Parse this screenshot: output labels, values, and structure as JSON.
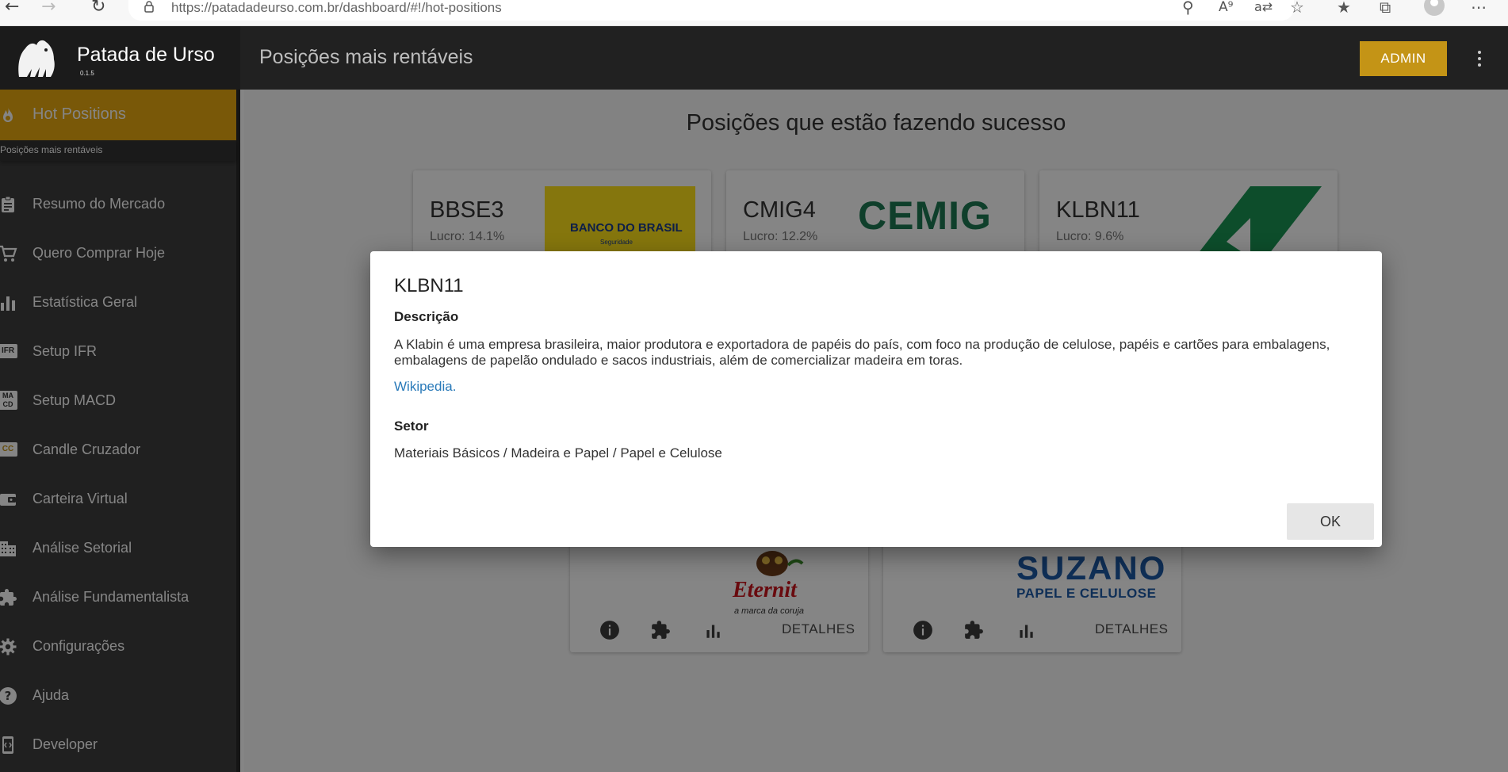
{
  "browser": {
    "url_host": "https://patadadeurso.com.br",
    "url_path": "/dashboard/#!/hot-positions"
  },
  "app": {
    "name": "Patada de Urso",
    "version": "0.1.5",
    "page_heading": "Posições mais rentáveis",
    "admin_label": "ADMIN"
  },
  "sidebar": {
    "active": {
      "label": "Hot Positions",
      "subtitle": "Posições mais rentáveis"
    },
    "items": [
      {
        "label": "Resumo do Mercado",
        "icon": "clipboard-icon"
      },
      {
        "label": "Quero Comprar Hoje",
        "icon": "cart-icon"
      },
      {
        "label": "Estatística Geral",
        "icon": "bar-chart-icon"
      },
      {
        "label": "Setup IFR",
        "icon": "ifr-icon",
        "icon_text": "IFR"
      },
      {
        "label": "Setup MACD",
        "icon": "macd-icon",
        "icon_text": "MA CD"
      },
      {
        "label": "Candle Cruzador",
        "icon": "candle-icon",
        "icon_text": "CC"
      },
      {
        "label": "Carteira Virtual",
        "icon": "wallet-icon"
      },
      {
        "label": "Análise Setorial",
        "icon": "building-icon"
      },
      {
        "label": "Análise Fundamentalista",
        "icon": "puzzle-icon"
      },
      {
        "label": "Configurações",
        "icon": "gear-icon"
      },
      {
        "label": "Ajuda",
        "icon": "help-icon"
      },
      {
        "label": "Developer",
        "icon": "developer-icon"
      }
    ]
  },
  "main": {
    "title": "Posições que estão fazendo sucesso",
    "cards": [
      {
        "ticker": "BBSE3",
        "profit": "Lucro: 14.1%",
        "logo_text": "BANCO DO BRASIL",
        "logo_sub": "Seguridade"
      },
      {
        "ticker": "CMIG4",
        "profit": "Lucro: 12.2%",
        "logo_text": "CEMIG"
      },
      {
        "ticker": "KLBN11",
        "profit": "Lucro: 9.6%"
      }
    ],
    "bottom_cards": [
      {
        "logo_text": "Eternit",
        "logo_sub": "a marca da coruja",
        "details_label": "DETALHES"
      },
      {
        "logo_text": "SUZANO",
        "logo_sub": "PAPEL E CELULOSE",
        "details_label": "DETALHES"
      }
    ]
  },
  "dialog": {
    "title": "KLBN11",
    "description_heading": "Descrição",
    "description": "A Klabin é uma empresa brasileira, maior produtora e exportadora de papéis do país, com foco na produção de celulose, papéis e cartões para embalagens, embalagens de papelão ondulado e sacos industriais, além de comercializar madeira em toras.",
    "link_label": "Wikipedia.",
    "sector_heading": "Setor",
    "sector": "Materiais Básicos / Madeira e Papel / Papel e Celulose",
    "ok_label": "OK"
  },
  "colors": {
    "accent": "#e8a911",
    "admin": "#c49416",
    "toolbar": "#212121",
    "sidebar": "#3f3f3f",
    "link": "#2a7ab9"
  }
}
